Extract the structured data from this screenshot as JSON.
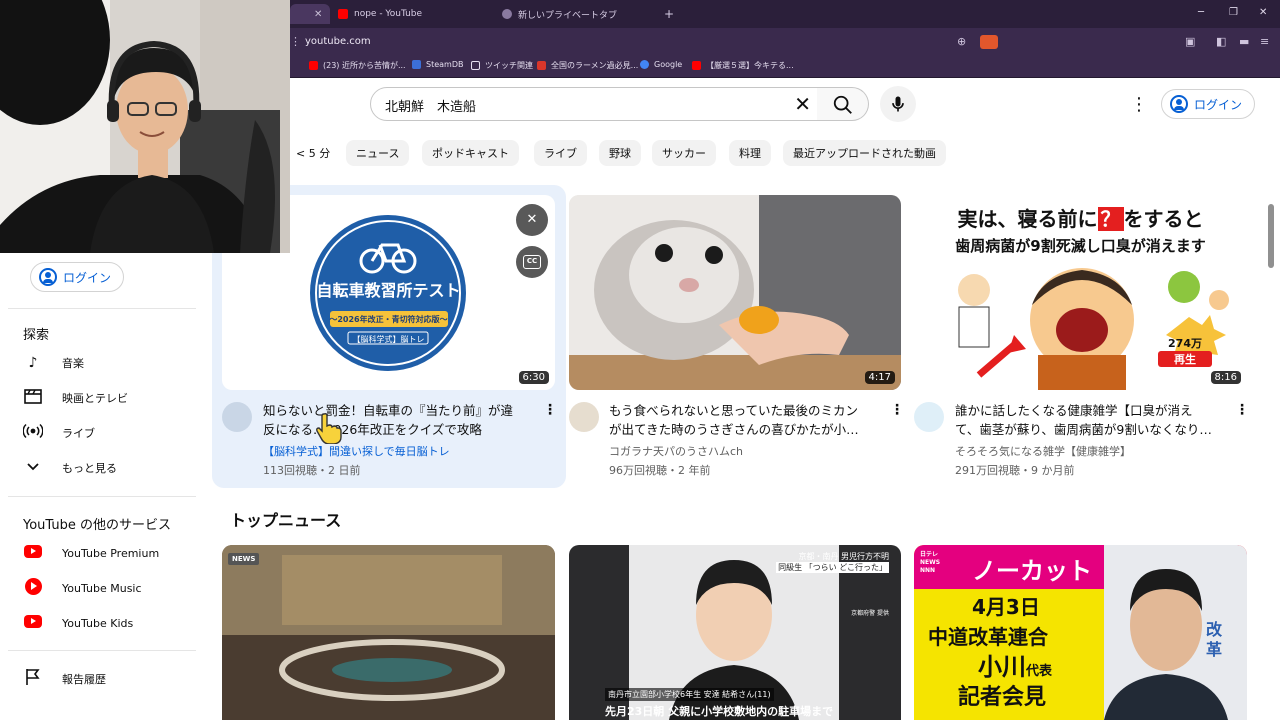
{
  "browser": {
    "tabs": [
      {
        "title": "nope - YouTube",
        "favicon": "youtube-icon"
      },
      {
        "title": "新しいプライベートタブ",
        "favicon": "shield-icon"
      }
    ],
    "new_tab": "+",
    "window_controls": [
      "─",
      "❐",
      "✕"
    ],
    "url": "youtube.com",
    "bookmarks": [
      "(23) 近所から苦情が...",
      "SteamDB",
      "ツイッチ関連",
      "全国のラーメン過必見...",
      "Google",
      "【厳選５選】今キテる..."
    ]
  },
  "header": {
    "search_query": "北朝鮮　木造船",
    "login_label": "ログイン"
  },
  "chips": [
    "< 5 分",
    "ニュース",
    "ポッドキャスト",
    "ライブ",
    "野球",
    "サッカー",
    "料理",
    "最近アップロードされた動画"
  ],
  "sidebar": {
    "login_label": "ログイン",
    "explore_heading": "探索",
    "explore_items": [
      {
        "label": "音楽",
        "icon": "music-note-icon"
      },
      {
        "label": "映画とテレビ",
        "icon": "clapperboard-icon"
      },
      {
        "label": "ライブ",
        "icon": "live-broadcast-icon"
      },
      {
        "label": "もっと見る",
        "icon": "chevron-down-icon"
      }
    ],
    "services_heading": "YouTube の他のサービス",
    "services": [
      {
        "label": "YouTube Premium",
        "icon": "youtube-premium-icon"
      },
      {
        "label": "YouTube Music",
        "icon": "youtube-music-icon"
      },
      {
        "label": "YouTube Kids",
        "icon": "youtube-kids-icon"
      }
    ],
    "report_label": "報告履歴"
  },
  "videos": [
    {
      "title_line1": "知らないと罰金！自転車の『当たり前』が違",
      "title_line2": "反になる…2026年改正をクイズで攻略",
      "channel": "【脳科学式】間違い探しで毎日脳トレ",
      "meta": "113回視聴・2 日前",
      "duration": "6:30",
      "thumb_title": "自転車教習所テスト",
      "thumb_sub": "〜2026年改正・青切符対応版〜",
      "thumb_badge": "【脳科学式】脳トレ",
      "cc": "CC"
    },
    {
      "title_line1": "もう食べられないと思っていた最後のミカン",
      "title_line2": "が出てきた時のうさぎさんの喜びかたが小…",
      "channel": "コガラナ天パのうさハムch",
      "meta": "96万回視聴・2 年前",
      "duration": "4:17"
    },
    {
      "title_line1": "誰かに話したくなる健康雑学【口臭が消え",
      "title_line2": "て、歯茎が蘇り、歯周病菌が9割いなくなり…",
      "channel": "そろそろ気になる雑学【健康雑学】",
      "meta": "291万回視聴・9 か月前",
      "duration": "8:16",
      "thumb_line1": "実は、寝る前に",
      "thumb_q": "？",
      "thumb_line1b": "をすると",
      "thumb_line2": "歯周病菌が9割死滅し口臭が消えます",
      "thumb_badge_num": "274万",
      "thumb_badge_txt": "再生"
    }
  ],
  "top_news": {
    "title": "トップニュース",
    "items": [
      {
        "badge": "NEWS"
      },
      {
        "overlay1": "京都・南丹 男児行方不明",
        "overlay2": "同級生 「つらい どこ行った」",
        "credit": "京都府警 提供",
        "caption": "南丹市立園部小学校6年生 安達 結希さん(11)",
        "ticker": "先月23日朝 父親に小学校敷地内の駐車場まで"
      },
      {
        "logo": "日テレ NEWS NNN",
        "headline": "ノーカット",
        "date": "4月3日",
        "line1": "中道改革連合",
        "line2a": "小川",
        "line2b": "代表",
        "line3": "記者会見",
        "bg_text": "改革"
      }
    ]
  },
  "colors": {
    "accent": "#065fd4",
    "brand_red": "#ff0000",
    "chip_bg": "#f2f2f2",
    "browser_bg": "#3a2a4d"
  }
}
